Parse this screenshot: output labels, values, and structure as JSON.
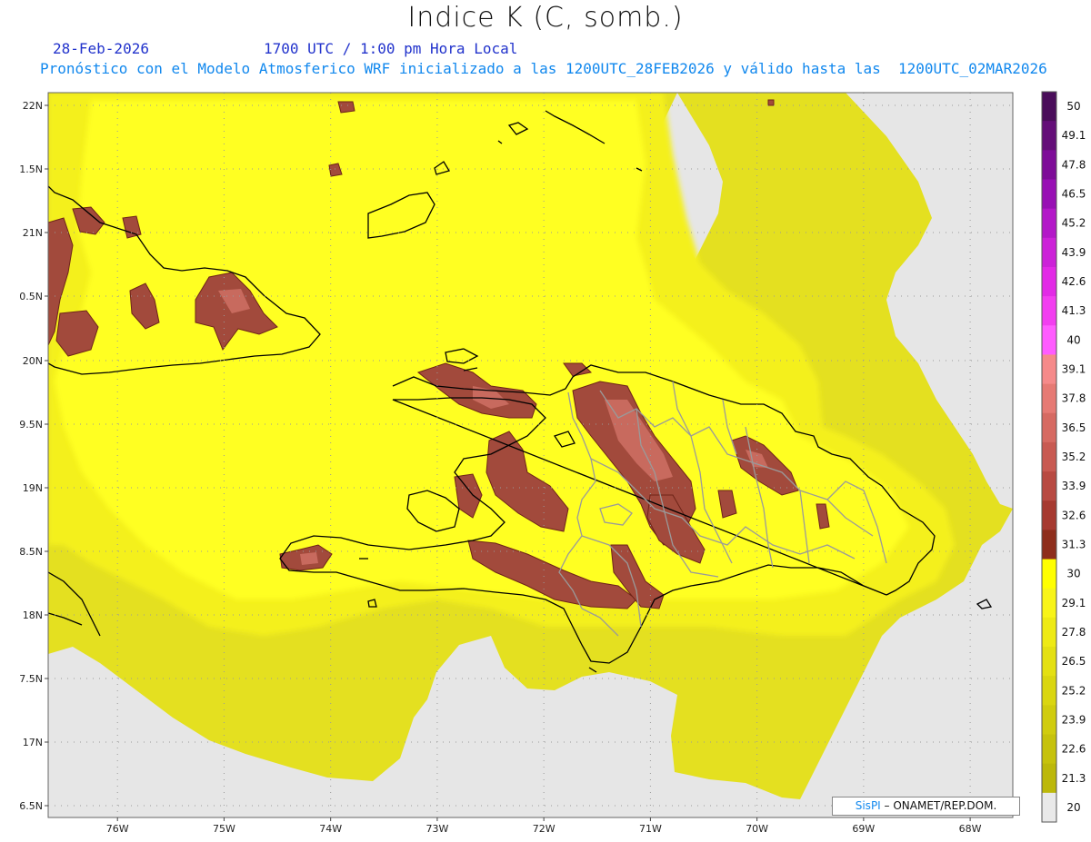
{
  "title": "Indice K (C, somb.)",
  "date": "28-Feb-2026",
  "time": "1700 UTC / 1:00 pm Hora Local",
  "model_line": "Pronóstico con el Modelo Atmosferico WRF inicializado a las 1200UTC_28FEB2026 y válido hasta las  1200UTC_02MAR2026",
  "credit": {
    "brand": "SisPI",
    "org": " ONAMET/REP.DOM."
  },
  "map": {
    "lon_range": [
      -76.65,
      -67.6
    ],
    "lat_range": [
      6.4,
      22.1
    ],
    "lat_labels": [
      {
        "lat": 22.0,
        "text": "22N"
      },
      {
        "lat": 21.5,
        "text": "1.5N"
      },
      {
        "lat": 21.0,
        "text": "21N"
      },
      {
        "lat": 20.5,
        "text": "0.5N"
      },
      {
        "lat": 20.0,
        "text": "20N"
      },
      {
        "lat": 19.5,
        "text": "9.5N"
      },
      {
        "lat": 19.0,
        "text": "19N"
      },
      {
        "lat": 18.5,
        "text": "8.5N"
      },
      {
        "lat": 18.0,
        "text": "18N"
      },
      {
        "lat": 17.5,
        "text": "7.5N"
      },
      {
        "lat": 17.0,
        "text": "17N"
      },
      {
        "lat": 6.5,
        "text": "6.5N"
      }
    ],
    "lon_labels": [
      {
        "lon": -76,
        "text": "76W"
      },
      {
        "lon": -75,
        "text": "75W"
      },
      {
        "lon": -74,
        "text": "74W"
      },
      {
        "lon": -73,
        "text": "73W"
      },
      {
        "lon": -72,
        "text": "72W"
      },
      {
        "lon": -71,
        "text": "71W"
      },
      {
        "lon": -70,
        "text": "70W"
      },
      {
        "lon": -69,
        "text": "69W"
      },
      {
        "lon": -68,
        "text": "68W"
      }
    ]
  },
  "colorbar": {
    "labels": [
      "50",
      "49.1",
      "47.8",
      "46.5",
      "45.2",
      "43.9",
      "42.6",
      "41.3",
      "40",
      "39.1",
      "37.8",
      "36.5",
      "35.2",
      "33.9",
      "32.6",
      "31.3",
      "30",
      "29.1",
      "27.8",
      "26.5",
      "25.2",
      "23.9",
      "22.6",
      "21.3",
      "20"
    ],
    "colors": [
      "#4a0d5a",
      "#640e78",
      "#7e0c98",
      "#9810b4",
      "#b318c8",
      "#cc22d8",
      "#e22ae6",
      "#f23ef0",
      "#ff5cff",
      "#f58a8a",
      "#e67a74",
      "#d66a62",
      "#c85a52",
      "#b84a42",
      "#a63a30",
      "#8e2e1c",
      "#ffff00",
      "#f8f418",
      "#eeea14",
      "#e4e012",
      "#dad610",
      "#d0cc0e",
      "#c6c20c",
      "#bcb80a",
      "#e9e9e9"
    ]
  }
}
